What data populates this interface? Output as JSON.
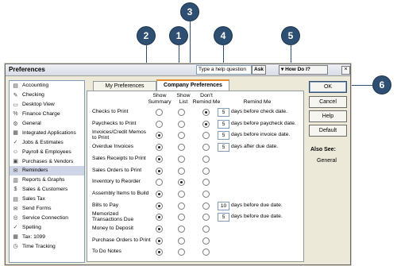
{
  "callouts": [
    "1",
    "2",
    "3",
    "4",
    "5",
    "6"
  ],
  "window": {
    "title": "Preferences",
    "help_placeholder": "Type a help question",
    "ask_label": "Ask",
    "howdoi_label": "How Do I?",
    "close_label": "×"
  },
  "sidebar": {
    "items": [
      {
        "label": "Accounting",
        "icon": "accounting-icon",
        "glyph": "▤"
      },
      {
        "label": "Checking",
        "icon": "checking-icon",
        "glyph": "✎"
      },
      {
        "label": "Desktop View",
        "icon": "desktop-view-icon",
        "glyph": "▭"
      },
      {
        "label": "Finance Charge",
        "icon": "finance-charge-icon",
        "glyph": "%"
      },
      {
        "label": "General",
        "icon": "general-icon",
        "glyph": "⚙"
      },
      {
        "label": "Integrated Applications",
        "icon": "integrated-applications-icon",
        "glyph": "▦"
      },
      {
        "label": "Jobs & Estimates",
        "icon": "jobs-estimates-icon",
        "glyph": "✓"
      },
      {
        "label": "Payroll & Employees",
        "icon": "payroll-employees-icon",
        "glyph": "☺"
      },
      {
        "label": "Purchases & Vendors",
        "icon": "purchases-vendors-icon",
        "glyph": "▣"
      },
      {
        "label": "Reminders",
        "icon": "reminders-icon",
        "glyph": "✉"
      },
      {
        "label": "Reports & Graphs",
        "icon": "reports-graphs-icon",
        "glyph": "▥"
      },
      {
        "label": "Sales & Customers",
        "icon": "sales-customers-icon",
        "glyph": "$"
      },
      {
        "label": "Sales Tax",
        "icon": "sales-tax-icon",
        "glyph": "▤"
      },
      {
        "label": "Send Forms",
        "icon": "send-forms-icon",
        "glyph": "✉"
      },
      {
        "label": "Service Connection",
        "icon": "service-connection-icon",
        "glyph": "◎"
      },
      {
        "label": "Spelling",
        "icon": "spelling-icon",
        "glyph": "✓"
      },
      {
        "label": "Tax: 1099",
        "icon": "tax-1099-icon",
        "glyph": "▦"
      },
      {
        "label": "Time Tracking",
        "icon": "time-tracking-icon",
        "glyph": "◷"
      }
    ],
    "selected": "Reminders"
  },
  "tabs": {
    "my": "My Preferences",
    "company": "Company Preferences"
  },
  "columns": {
    "summary": "Show Summary",
    "list": "Show List",
    "dont": "Don't Remind Me",
    "remind": "Remind Me"
  },
  "rows": [
    {
      "label": "Checks to Print",
      "sel": 2,
      "days": "5",
      "after": "days before check date."
    },
    {
      "label": "Paychecks to Print",
      "sel": 2,
      "days": "5",
      "after": "days before paycheck date."
    },
    {
      "label": "Invoices/Credit Memos to Print",
      "sel": 0,
      "days": "5",
      "after": "days before invoice date."
    },
    {
      "label": "Overdue Invoices",
      "sel": 0,
      "days": "5",
      "after": "days after due date."
    },
    {
      "label": "Sales Receipts to Print",
      "sel": 0,
      "days": "",
      "after": ""
    },
    {
      "label": "Sales Orders to Print",
      "sel": 0,
      "days": "",
      "after": ""
    },
    {
      "label": "Inventory to Reorder",
      "sel": 1,
      "days": "",
      "after": ""
    },
    {
      "label": "Assembly Items to Build",
      "sel": 0,
      "days": "",
      "after": ""
    },
    {
      "label": "Bills to Pay",
      "sel": 0,
      "days": "10",
      "after": "days before due date."
    },
    {
      "label": "Memorized Transactions Due",
      "sel": 0,
      "days": "5",
      "after": "days before due date."
    },
    {
      "label": "Money to Deposit",
      "sel": 0,
      "days": "",
      "after": ""
    },
    {
      "label": "Purchase Orders to Print",
      "sel": 0,
      "days": "",
      "after": ""
    },
    {
      "label": "To Do Notes",
      "sel": 0,
      "days": "",
      "after": ""
    }
  ],
  "buttons": {
    "ok": "OK",
    "cancel": "Cancel",
    "help": "Help",
    "default": "Default"
  },
  "also_see": {
    "title": "Also See:",
    "link": "General"
  }
}
